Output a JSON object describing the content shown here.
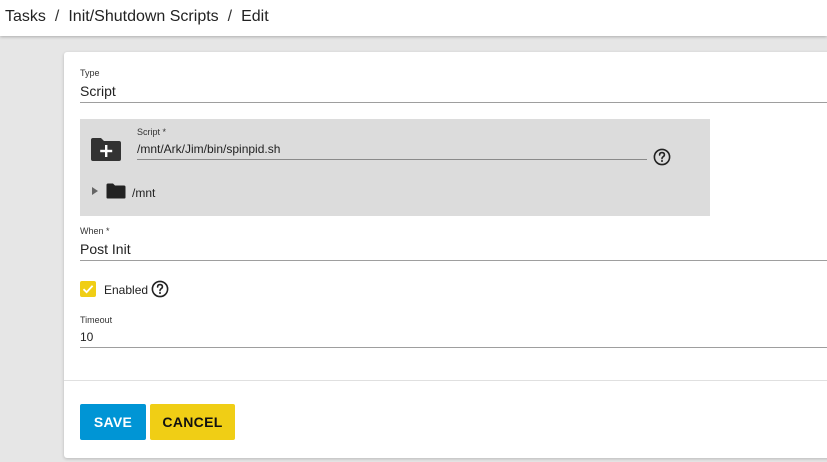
{
  "breadcrumb": {
    "items": [
      "Tasks",
      "Init/Shutdown Scripts",
      "Edit"
    ],
    "separator": "/"
  },
  "form": {
    "type": {
      "label": "Type",
      "value": "Script"
    },
    "script": {
      "label": "Script *",
      "value": "/mnt/Ark/Jim/bin/spinpid.sh",
      "tree_root": "/mnt"
    },
    "when": {
      "label": "When *",
      "value": "Post Init"
    },
    "enabled": {
      "label": "Enabled",
      "checked": true
    },
    "timeout": {
      "label": "Timeout",
      "value": "10"
    }
  },
  "actions": {
    "save_label": "SAVE",
    "cancel_label": "CANCEL"
  },
  "colors": {
    "primary": "#0095d5",
    "accent": "#f0ce15",
    "panel": "#dcdcdc",
    "background": "#e6e6e6"
  },
  "icons": {
    "folder_add": "folder-plus-icon",
    "folder": "folder-icon",
    "help": "help-circle-icon",
    "expand": "triangle-right-icon",
    "check": "check-icon"
  }
}
